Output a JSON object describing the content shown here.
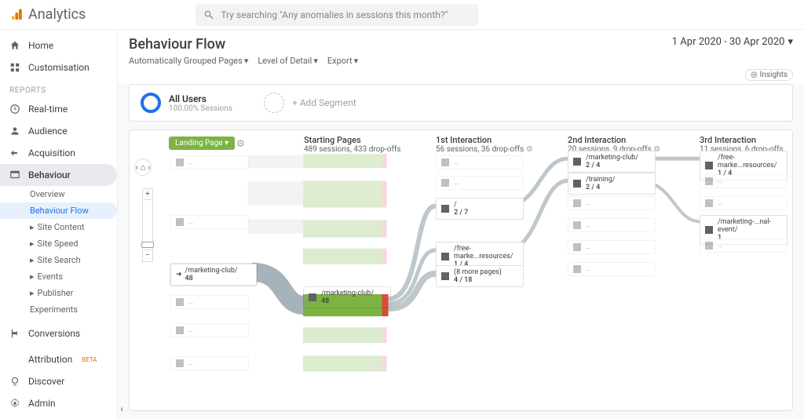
{
  "brand": "Analytics",
  "search_placeholder": "Try searching \"Any anomalies in sessions this month?\"",
  "nav": {
    "home": "Home",
    "customisation": "Customisation",
    "reports_label": "REPORTS",
    "realtime": "Real-time",
    "audience": "Audience",
    "acquisition": "Acquisition",
    "behaviour": "Behaviour",
    "behaviour_children": {
      "overview": "Overview",
      "behaviour_flow": "Behaviour Flow",
      "site_content": "Site Content",
      "site_speed": "Site Speed",
      "site_search": "Site Search",
      "events": "Events",
      "publisher": "Publisher",
      "experiments": "Experiments"
    },
    "conversions": "Conversions",
    "attribution": "Attribution",
    "attribution_beta": "BETA",
    "discover": "Discover",
    "admin": "Admin"
  },
  "page": {
    "title": "Behaviour Flow",
    "toolbar": {
      "dim": "Automatically Grouped Pages",
      "detail": "Level of Detail",
      "export": "Export"
    },
    "date_range": "1 Apr 2020 - 30 Apr 2020",
    "insights_label": "Insights"
  },
  "segments": {
    "all_users": "All Users",
    "all_users_sub": "100.00% Sessions",
    "add": "+ Add Segment"
  },
  "flow": {
    "landing_dd": "Landing Page",
    "cols": [
      {
        "title": "Starting Pages",
        "sub": "489 sessions, 433 drop-offs"
      },
      {
        "title": "1st Interaction",
        "sub": "56 sessions, 36 drop-offs"
      },
      {
        "title": "2nd Interaction",
        "sub": "20 sessions, 9 drop-offs"
      },
      {
        "title": "3rd Interaction",
        "sub": "11 sessions, 6 drop-offs"
      }
    ],
    "nodes": {
      "landing_hl": {
        "label": "/marketing-club/",
        "val": "48"
      },
      "start_hl": {
        "label": "/marketing-club/",
        "val": "48"
      },
      "i1_a": {
        "label": "/",
        "val": "2 / 7"
      },
      "i1_b": {
        "label": "/free-marke...resources/",
        "val": "1 / 4"
      },
      "i1_c": {
        "label": "(8 more pages)",
        "val": "4 / 18"
      },
      "i2_a": {
        "label": "/marketing-club/",
        "val": "2 / 4"
      },
      "i2_b": {
        "label": "/training/",
        "val": "2 / 4"
      },
      "i3_a": {
        "label": "/free-marke...resources/",
        "val": "1 / 4"
      },
      "i3_b": {
        "label": "/marketing-...nal-event/",
        "val": "1"
      }
    }
  }
}
